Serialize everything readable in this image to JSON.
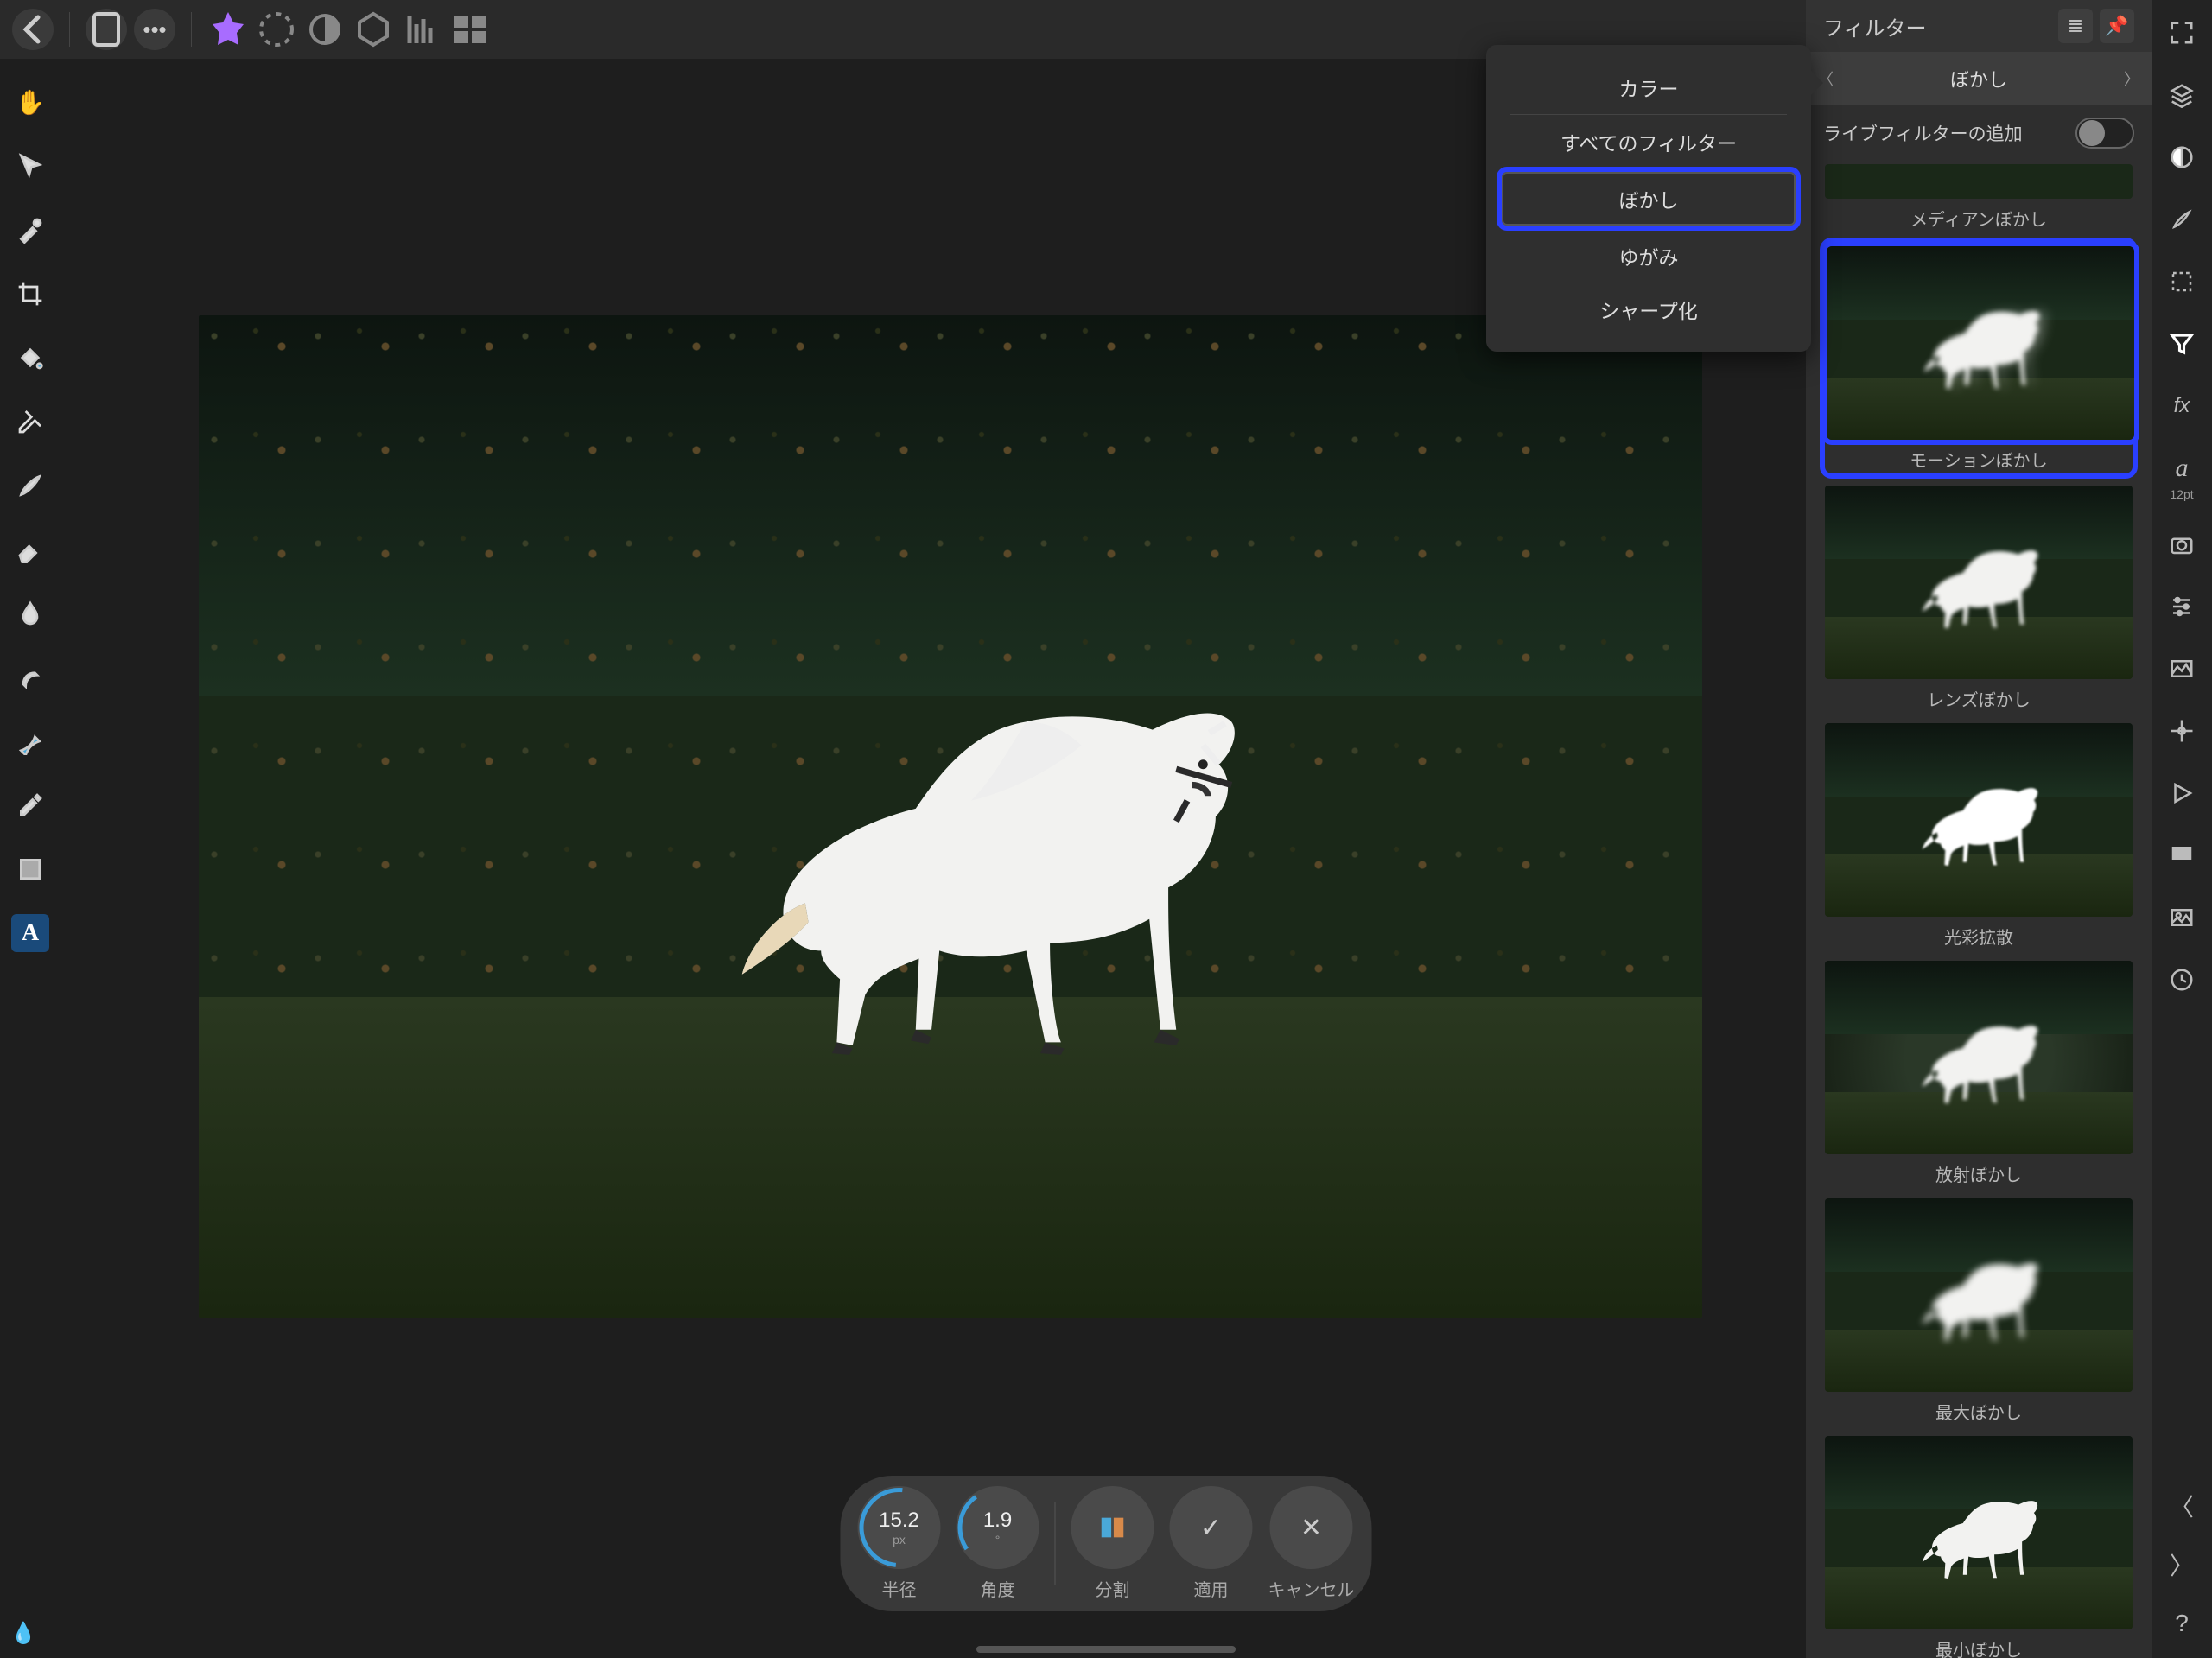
{
  "panel": {
    "title": "フィルター"
  },
  "category": {
    "current": "ぼかし"
  },
  "liveFilter": {
    "label": "ライブフィルターの追加",
    "on": false
  },
  "popover": {
    "items": [
      {
        "label": "カラー",
        "divider_after": true
      },
      {
        "label": "すべてのフィルター"
      },
      {
        "label": "ぼかし",
        "highlighted": true
      },
      {
        "label": "ゆがみ"
      },
      {
        "label": "シャープ化"
      }
    ]
  },
  "filters": [
    {
      "label": "メディアンぼかし",
      "variant": "first"
    },
    {
      "label": "モーションぼかし",
      "variant": "motion",
      "highlighted": true
    },
    {
      "label": "レンズぼかし",
      "variant": "lens"
    },
    {
      "label": "光彩拡散",
      "variant": "diffuse"
    },
    {
      "label": "放射ぼかし",
      "variant": "radial"
    },
    {
      "label": "最大ぼかし",
      "variant": "max"
    },
    {
      "label": "最小ぼかし",
      "variant": "min"
    }
  ],
  "controls": {
    "radius": {
      "value": "15.2",
      "unit": "px",
      "label": "半径"
    },
    "angle": {
      "value": "1.9",
      "unit": "°",
      "label": "角度"
    },
    "split": {
      "label": "分割"
    },
    "apply": {
      "label": "適用"
    },
    "cancel": {
      "label": "キャンセル"
    }
  },
  "rightStrip": {
    "fontSizeLabel": "12pt"
  }
}
